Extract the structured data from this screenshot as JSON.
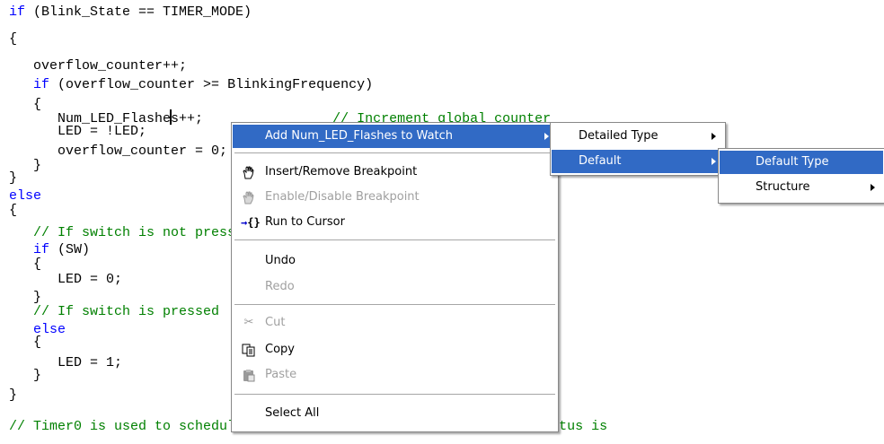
{
  "code_lines": [
    [
      {
        "t": "if",
        "c": "kw"
      },
      {
        "t": " (Blink_State == TIMER_MODE)",
        "c": ""
      }
    ],
    [
      {
        "t": "{",
        "c": ""
      }
    ],
    [
      {
        "t": "   overflow_counter++;",
        "c": ""
      }
    ],
    [],
    [
      {
        "t": "   ",
        "c": ""
      },
      {
        "t": "if",
        "c": "kw"
      },
      {
        "t": " (overflow_counter >= BlinkingFrequency)",
        "c": ""
      }
    ],
    [
      {
        "t": "   {",
        "c": ""
      }
    ],
    [
      {
        "t": "      Num_LED_Flashe",
        "c": ""
      },
      {
        "t": "",
        "c": "caret"
      },
      {
        "t": "s++;",
        "c": ""
      },
      {
        "t": "                // Increment global counter",
        "c": "cm"
      }
    ],
    [
      {
        "t": "      LED = !LED;",
        "c": ""
      }
    ],
    [
      {
        "t": "      overflow_counter = 0;",
        "c": ""
      }
    ],
    [
      {
        "t": "   }",
        "c": ""
      }
    ],
    [
      {
        "t": "}",
        "c": ""
      }
    ],
    [
      {
        "t": "else",
        "c": "kw"
      }
    ],
    [
      {
        "t": "{",
        "c": ""
      }
    ],
    [
      {
        "t": "   ",
        "c": ""
      },
      {
        "t": "// If switch is not pressed",
        "c": "cm"
      }
    ],
    [
      {
        "t": "   ",
        "c": ""
      },
      {
        "t": "if",
        "c": "kw"
      },
      {
        "t": " (SW)",
        "c": ""
      }
    ],
    [
      {
        "t": "   {",
        "c": ""
      }
    ],
    [
      {
        "t": "      LED = 0;",
        "c": ""
      }
    ],
    [
      {
        "t": "   }",
        "c": ""
      }
    ],
    [
      {
        "t": "   ",
        "c": ""
      },
      {
        "t": "// If switch is pressed",
        "c": "cm"
      }
    ],
    [
      {
        "t": "   ",
        "c": ""
      },
      {
        "t": "else",
        "c": "kw"
      }
    ],
    [
      {
        "t": "   {",
        "c": ""
      }
    ],
    [
      {
        "t": "      LED = 1;",
        "c": ""
      }
    ],
    [
      {
        "t": "   }",
        "c": ""
      }
    ],
    [
      {
        "t": "}",
        "c": ""
      }
    ],
    [],
    [
      {
        "t": "// Timer0 is used to schedule the number of times per second the status is",
        "c": "cm"
      }
    ]
  ],
  "context_menu": {
    "add_watch": "Add Num_LED_Flashes to Watch",
    "insert_remove_breakpoint": "Insert/Remove Breakpoint",
    "enable_disable_breakpoint": "Enable/Disable Breakpoint",
    "run_to_cursor": "Run to Cursor",
    "undo": "Undo",
    "redo": "Redo",
    "cut": "Cut",
    "copy": "Copy",
    "paste": "Paste",
    "select_all": "Select All"
  },
  "watch_submenu": {
    "detailed_type": "Detailed Type",
    "default": "Default"
  },
  "default_submenu": {
    "default_type": "Default Type",
    "structure": "Structure"
  },
  "icons": {
    "insert_remove_breakpoint": "hand-icon",
    "enable_disable_breakpoint": "hand-disabled-icon",
    "run_to_cursor": "run-to-cursor-icon",
    "cut": "scissors-icon",
    "copy": "copy-icon",
    "paste": "paste-icon"
  },
  "colors": {
    "keyword": "#0000ff",
    "comment": "#008000",
    "highlight": "#316ac5"
  }
}
